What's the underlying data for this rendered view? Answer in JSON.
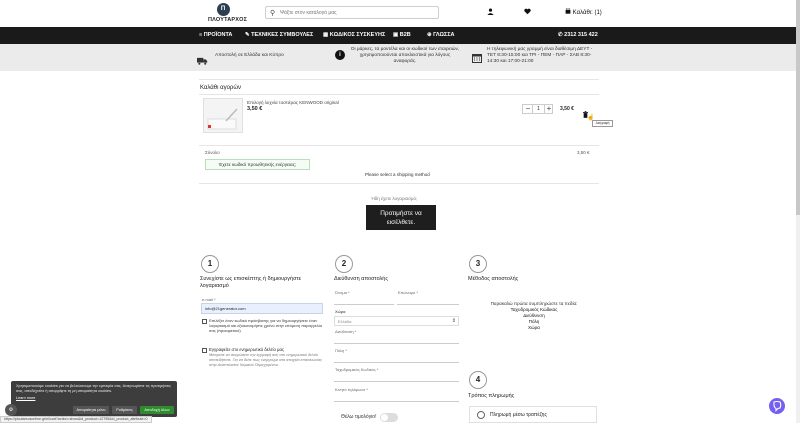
{
  "header": {
    "logo_text": "ΠΛΟΥΤΑΡΧΟΣ",
    "logo_mark": "Π",
    "search_placeholder": "Ψάξτε στον κατάλογό μας",
    "cart_label": "Καλάθι: (1)"
  },
  "nav": {
    "items": [
      "ΠΡΟΪΟΝΤΑ",
      "ΤΕΧΝΙΚΕΣ ΣΥΜΒΟΥΛΕΣ",
      "ΚΩΔΙΚΟΣ ΣΥΣΚΕΥΗΣ",
      "B2B",
      "ΓΛΩΣΣΑ"
    ],
    "phone": "2312 315 422"
  },
  "info": {
    "shipping": "Αποστολή σε Ελλάδα και Κύπρο",
    "notice": "Οι μάρκες, τα μοντέλα και οι κωδικοί των εταιρειών, χρησιμοποιούνται αποκλειστικά για λόγους αναφοράς.",
    "hours": "Η τηλεφωνική μας γραμμή είναι διαθέσιμη ΔΕΥΤ - ΤΕΤ 8:30-15:00 και ΤΡΙ - ΠΕΜ - ΠΑΡ - ΣΑΒ 8:30-14:30 και 17:00-21:00"
  },
  "cart": {
    "title": "Καλάθι αγορών",
    "product_name": "Επιλογή λυχνία τοστιέρας KENWOOD original",
    "product_price": "3,50 €",
    "quantity": "1",
    "line_total": "3,50 €",
    "delete_tooltip": "Διαγραφή",
    "total_label": "Σύνολο",
    "total_value": "3,50 €",
    "coupon_button": "Έχετε κωδικό προωθητικής ενέργειας;",
    "shipping_note": "Please select a shipping method",
    "login_prompt": "Ήδη έχετε λογαριασμό;",
    "login_button": "Προτιμήστε να εισέλθετε."
  },
  "step1": {
    "number": "1",
    "title": "Συνεχίστε ως επισκέπτης ή δημιουργήστε λογαριασμό",
    "email_label": "e-mail *",
    "email_value": "info@21generator.com",
    "create_account": "Επιλέξτε έναν κωδικό πρόσβασης για να δημιουργήσετε έναν λογαριασμό και εξοικονομήστε χρόνο στην επόμενη παραγγελία σας (προαιρετικό)",
    "newsletter": "Εγγραφείτε στο ενημερωτικό δελτίο μας",
    "newsletter_note": "Μπορείτε να ακυρώσετε την εγγραφή σας στο ενημερωτικό δελτίο οποτεδήποτε. Για να δείτε πως ενεργούμε στα στοιχεία επικοινωνίας στην Αναπτύσσον Νομικού Περιεχομένου."
  },
  "step2": {
    "number": "2",
    "title": "Διεύθυνση αποστολής",
    "fields": {
      "first_name": "Όνομα *",
      "last_name": "Επώνυμο *",
      "country_label": "Χώρα",
      "country_value": "Ελλάδα",
      "address": "Διεύθυνση *",
      "city": "Πόλη *",
      "postcode": "Ταχυδρομικός Κωδικός *",
      "phone": "Κινητό τηλέφωνο *"
    },
    "invoice_label": "Θέλω τιμολόγιο!"
  },
  "step3": {
    "number": "3",
    "title": "Μέθοδος αποστολής",
    "prompt": "Παρακαλώ πρώτα συμπληρώστε τα πεδία:",
    "required": [
      "Ταχυδρομικός Κώδικας",
      "Διεύθυνση",
      "Πόλη",
      "Χώρα"
    ]
  },
  "step4": {
    "number": "4",
    "title": "Τρόπος πληρωμής",
    "option1": "Πληρωμή μέσω τραπέζης"
  },
  "cookie": {
    "text": "Χρησιμοποιούμε cookies για να βελτιώσουμε την εμπειρία σας. Αναγνωρίστε τις προτιμήσεις σας, αποδεχτείτε ή απορρίψτε τη μη απαραίτητα cookies.",
    "learn_more": "Learn more",
    "accept_essential": "Απαραίτητα μόνο",
    "settings": "Ρυθμίσεις",
    "accept_all": "Αποδοχή όλων"
  },
  "status_url": "https://ploutarxosonline.gr/el/cart?action=show&id_product=12795&id_product_attribute=0",
  "colors": {
    "nav_bg": "#1a1a1a",
    "login_button_bg": "#1e1e1e",
    "accept_all_bg": "#2e8b2e",
    "viber": "#7360f2",
    "coupon_border": "#b9dfb9"
  },
  "icons": [
    "search-icon",
    "user-icon",
    "heart-icon",
    "cart-icon",
    "truck-icon",
    "info-icon",
    "calendar-icon",
    "phone-icon",
    "trash-icon",
    "viber-icon"
  ]
}
